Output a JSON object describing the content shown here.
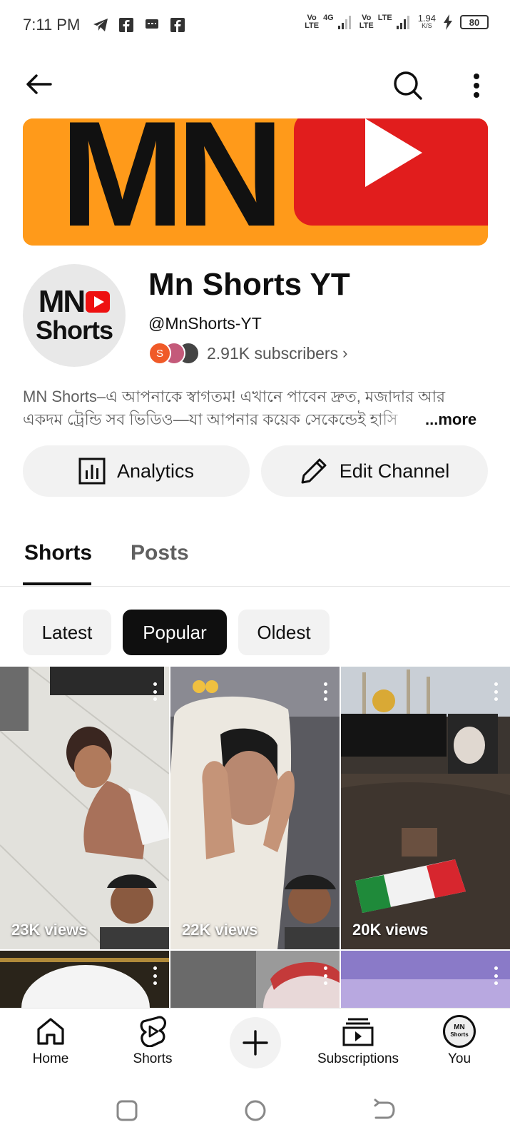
{
  "status_bar": {
    "time": "7:11 PM",
    "sim1_label_top": "Vo",
    "sim1_label_bottom": "LTE",
    "sim1_net": "4G",
    "sim2_label_top": "Vo",
    "sim2_label_bottom": "LTE",
    "sim2_net": "LTE",
    "speed_value": "1.94",
    "speed_unit": "K/S",
    "battery": "80"
  },
  "banner": {
    "text": "MN"
  },
  "channel": {
    "avatar_line1": "MN",
    "avatar_line2": "Shorts",
    "name": "Mn Shorts YT",
    "handle": "@MnShorts-YT",
    "subscriber_avatar_letter": "S",
    "subscribers": "2.91K subscribers",
    "description_line1": "MN Shorts–এ আপনাকে স্বাগতম! এখানে পাবেন দ্রুত, মজাদার আর",
    "description_line2": "একদম ট্রেন্ডি সব ভিডিও—যা আপনার কয়েক সেকেন্ডেই হাসি",
    "more_label": "...more"
  },
  "actions": {
    "analytics_label": "Analytics",
    "edit_label": "Edit Channel"
  },
  "tabs": [
    {
      "label": "Shorts",
      "active": true
    },
    {
      "label": "Posts",
      "active": false
    }
  ],
  "chips": [
    {
      "label": "Latest",
      "selected": false
    },
    {
      "label": "Popular",
      "selected": true
    },
    {
      "label": "Oldest",
      "selected": false
    }
  ],
  "shorts": [
    {
      "views": "23K views"
    },
    {
      "views": "22K views"
    },
    {
      "views": "20K views"
    }
  ],
  "bottom_nav": {
    "home": "Home",
    "shorts": "Shorts",
    "subscriptions": "Subscriptions",
    "you": "You",
    "you_avatar_line1": "MN",
    "you_avatar_line2": "Shorts"
  },
  "icons": {
    "back": "arrow-left-icon",
    "search": "search-icon",
    "more": "more-vertical-icon",
    "analytics": "analytics-icon",
    "edit": "pencil-icon",
    "create": "plus-icon"
  },
  "colors": {
    "banner_orange": "#ff9a1a",
    "youtube_red": "#e11d1d",
    "chip_selected": "#0f0f0f",
    "chip_default": "#f2f2f2"
  }
}
